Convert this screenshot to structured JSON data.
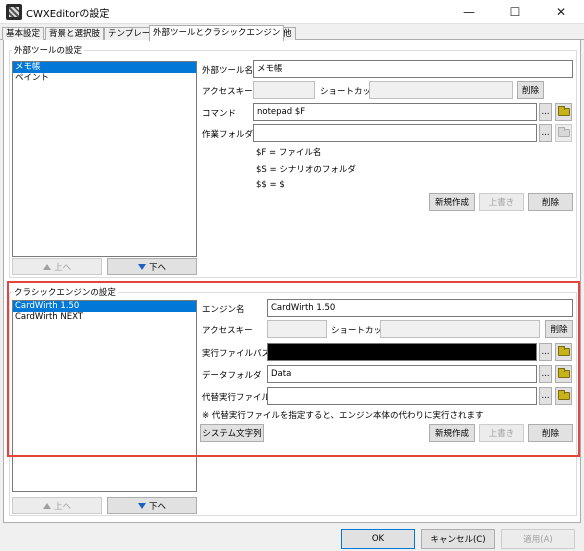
{
  "window": {
    "title": "CWXEditorの設定",
    "minimize": "—",
    "maximize": "☐",
    "close": "✕"
  },
  "tabs": [
    "基本設定",
    "背景と選択肢",
    "テンプレート",
    "外部ツールとクラシックエンジン",
    "その他"
  ],
  "external_tools": {
    "group_title": "外部ツールの設定",
    "list": [
      "メモ帳",
      "ペイント"
    ],
    "up_label": "上へ",
    "down_label": "下へ",
    "name_label": "外部ツール名",
    "name_value": "メモ帳",
    "accesskey_label": "アクセスキー",
    "accesskey_value": "",
    "shortcut_label": "ショートカット",
    "shortcut_value": "",
    "shortcut_delete": "削除",
    "command_label": "コマンド",
    "command_value": "notepad $F",
    "browse_label": "...",
    "workdir_label": "作業フォルダ",
    "workdir_value": "",
    "help_lines": [
      "$F = ファイル名",
      "$S = シナリオのフォルダ",
      "$$ = $"
    ],
    "new_label": "新規作成",
    "overwrite_label": "上書き",
    "delete_label": "削除"
  },
  "classic_engine": {
    "group_title": "クラシックエンジンの設定",
    "list": [
      "CardWirth 1.50",
      "CardWirth NEXT"
    ],
    "up_label": "上へ",
    "down_label": "下へ",
    "engine_name_label": "エンジン名",
    "engine_name_value": "CardWirth 1.50",
    "accesskey_label": "アクセスキー",
    "accesskey_value": "",
    "shortcut_label": "ショートカット",
    "shortcut_value": "",
    "shortcut_delete": "削除",
    "exe_label": "実行ファイルパス",
    "exe_value": "",
    "data_folder_label": "データフォルダ",
    "data_folder_value": "Data",
    "alt_exe_label": "代替実行ファイル",
    "alt_exe_value": "",
    "browse_label": "...",
    "note": "※ 代替実行ファイルを指定すると、エンジン本体の代わりに実行されます",
    "system_text_label": "システム文字列",
    "new_label": "新規作成",
    "overwrite_label": "上書き",
    "delete_label": "削除"
  },
  "dialog_buttons": {
    "ok": "OK",
    "cancel": "キャンセル(C)",
    "apply": "適用(A)"
  },
  "colors": {
    "selection": "#0078d7",
    "highlight_frame": "#e3453d",
    "folder_icon": "#c8b21c"
  }
}
